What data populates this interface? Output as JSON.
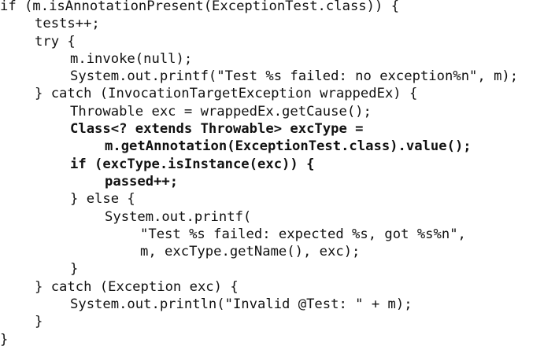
{
  "code": {
    "lines": [
      {
        "text": "if (m.isAnnotationPresent(ExceptionTest.class)) {",
        "indent": 0,
        "bold": false
      },
      {
        "text": "tests++;",
        "indent": 1,
        "bold": false
      },
      {
        "text": "try {",
        "indent": 1,
        "bold": false
      },
      {
        "text": "m.invoke(null);",
        "indent": 2,
        "bold": false
      },
      {
        "text": "System.out.printf(\"Test %s failed: no exception%n\", m);",
        "indent": 2,
        "bold": false
      },
      {
        "text": "} catch (InvocationTargetException wrappedEx) {",
        "indent": 1,
        "bold": false
      },
      {
        "text": "Throwable exc = wrappedEx.getCause();",
        "indent": 2,
        "bold": false
      },
      {
        "text": "Class<? extends Throwable> excType =",
        "indent": 2,
        "bold": true
      },
      {
        "text": "m.getAnnotation(ExceptionTest.class).value();",
        "indent": 3,
        "bold": true
      },
      {
        "text": "if (excType.isInstance(exc)) {",
        "indent": 2,
        "bold": true
      },
      {
        "text": "passed++;",
        "indent": 3,
        "bold": true
      },
      {
        "text": "} else {",
        "indent": 2,
        "bold": false
      },
      {
        "text": "System.out.printf(",
        "indent": 3,
        "bold": false
      },
      {
        "text": "\"Test %s failed: expected %s, got %s%n\",",
        "indent": 4,
        "bold": false
      },
      {
        "text": "m, excType.getName(), exc);",
        "indent": 4,
        "bold": false
      },
      {
        "text": "}",
        "indent": 2,
        "bold": false
      },
      {
        "text": "} catch (Exception exc) {",
        "indent": 1,
        "bold": false
      },
      {
        "text": "System.out.println(\"Invalid @Test: \" + m);",
        "indent": 2,
        "bold": false
      },
      {
        "text": "}",
        "indent": 1,
        "bold": false
      },
      {
        "text": "}",
        "indent": 0,
        "bold": false
      }
    ]
  }
}
